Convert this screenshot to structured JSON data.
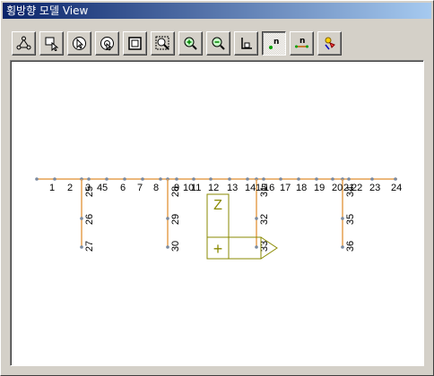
{
  "window": {
    "title": "횡방향 모델 View"
  },
  "toolbar": {
    "buttons": [
      {
        "name": "node-select-button",
        "icon": "node-select-icon",
        "pressed": false
      },
      {
        "name": "move-button",
        "icon": "move-cursor-icon",
        "pressed": false
      },
      {
        "name": "pointer-button",
        "icon": "pointer-circle-icon",
        "pressed": false
      },
      {
        "name": "rotate-button",
        "icon": "rotate-circle-icon",
        "pressed": false
      },
      {
        "name": "zoom-all-button",
        "icon": "zoom-extent-icon",
        "pressed": false
      },
      {
        "name": "zoom-window-button",
        "icon": "zoom-window-icon",
        "pressed": false
      },
      {
        "name": "zoom-in-button",
        "icon": "zoom-in-icon",
        "pressed": false
      },
      {
        "name": "zoom-out-button",
        "icon": "zoom-out-icon",
        "pressed": false
      },
      {
        "name": "axis-button",
        "icon": "axis-icon",
        "pressed": false
      },
      {
        "name": "node-number-button",
        "icon": "node-number-icon",
        "pressed": true
      },
      {
        "name": "element-number-button",
        "icon": "element-number-icon",
        "pressed": false
      },
      {
        "name": "support-button",
        "icon": "support-icon",
        "pressed": false
      }
    ]
  },
  "model": {
    "colors": {
      "member": "#e6a050",
      "node": "#7a8aa0",
      "symbol": "#8a8a00"
    },
    "node_labels": [
      "1",
      "2",
      "3",
      "4",
      "5",
      "6",
      "7",
      "8",
      "9",
      "10",
      "11",
      "12",
      "13",
      "14",
      "15",
      "16",
      "17",
      "18",
      "19",
      "20",
      "21",
      "22",
      "23",
      "24"
    ],
    "element_labels": [
      "25",
      "26",
      "27",
      "28",
      "29",
      "30",
      "31",
      "32",
      "33",
      "34",
      "35",
      "36"
    ],
    "axis_symbol": {
      "top_glyph": "Z",
      "bottom_glyph": "+"
    }
  }
}
